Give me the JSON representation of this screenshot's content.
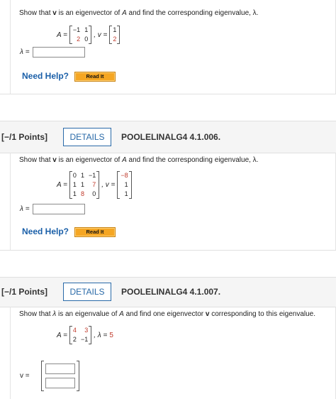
{
  "q1": {
    "prompt_pre": "Show that ",
    "prompt_v": "v",
    "prompt_mid": " is an eigenvector of ",
    "prompt_A": "A",
    "prompt_post": " and find the corresponding eigenvalue, λ.",
    "A_label": "A =",
    "A": [
      [
        "−1",
        "1"
      ],
      [
        "2",
        "0"
      ]
    ],
    "v_label": ", v =",
    "v": [
      "1",
      "2"
    ],
    "answer_label": "λ =",
    "answer_value": "",
    "need_help": "Need Help?",
    "read_it": "Read It"
  },
  "q2": {
    "points": "[−/1 Points]",
    "details": "DETAILS",
    "code": "POOLELINALG4 4.1.006.",
    "prompt_pre": "Show that ",
    "prompt_v": "v",
    "prompt_mid": " is an eigenvector of ",
    "prompt_A": "A",
    "prompt_post": " and find the corresponding eigenvalue, λ.",
    "A_label": "A =",
    "A": [
      [
        "0",
        "1",
        "−1"
      ],
      [
        "1",
        "1",
        "7"
      ],
      [
        "1",
        "8",
        "0"
      ]
    ],
    "v_label": ", v =",
    "v": [
      "−8",
      "1",
      "1"
    ],
    "answer_label": "λ =",
    "answer_value": "",
    "need_help": "Need Help?",
    "read_it": "Read It"
  },
  "q3": {
    "points": "[−/1 Points]",
    "details": "DETAILS",
    "code": "POOLELINALG4 4.1.007.",
    "prompt_pre": "Show that ",
    "prompt_lam": "λ",
    "prompt_mid": " is an eigenvalue of ",
    "prompt_A": "A",
    "prompt_mid2": " and find one eigenvector ",
    "prompt_v": "v",
    "prompt_post": " corresponding to this eigenvalue.",
    "A_label": "A =",
    "A": [
      [
        "4",
        "3"
      ],
      [
        "2",
        "−1"
      ]
    ],
    "lambda_label": ", λ =",
    "lambda_value": "5",
    "answer_label": "v =",
    "answer_values": [
      "",
      ""
    ]
  },
  "colors": {
    "accent": "#2a6aa8",
    "link": "#1a5fa8",
    "readit": "#f5a623",
    "red": "#c0392b"
  }
}
